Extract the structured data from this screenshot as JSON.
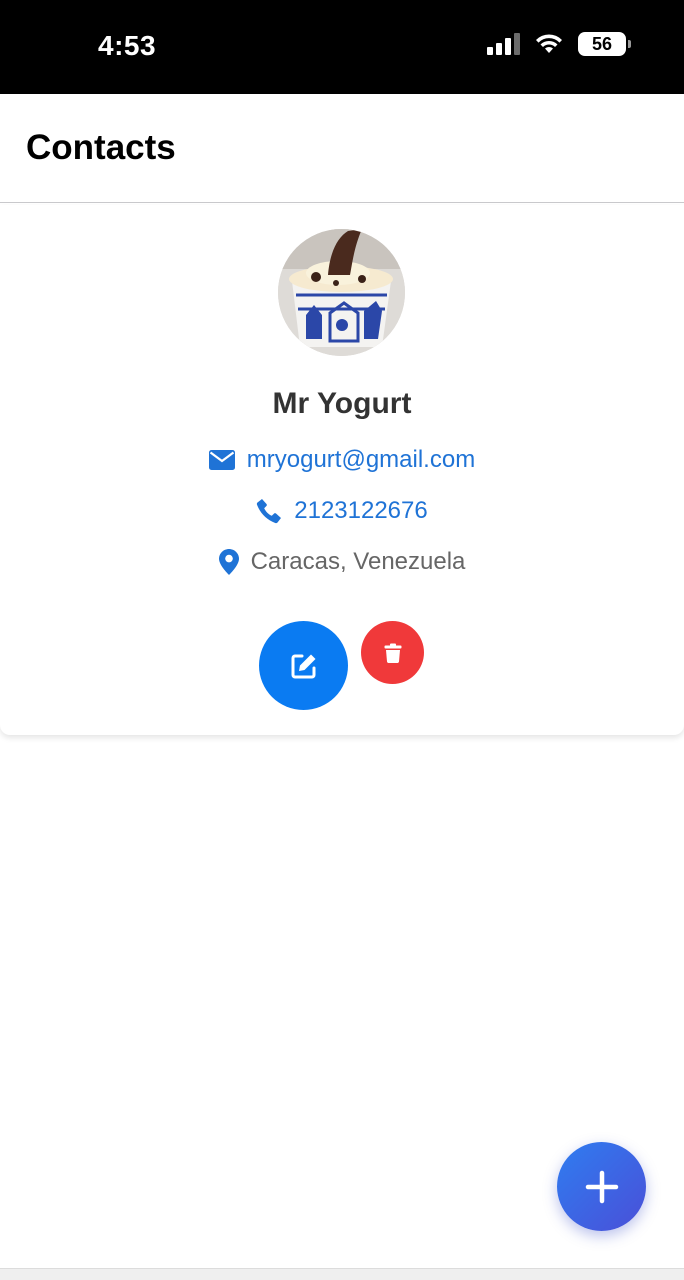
{
  "status_bar": {
    "time": "4:53",
    "battery_level": "56",
    "icons": [
      "cellular-signal-icon",
      "wifi-icon",
      "battery-icon"
    ]
  },
  "header": {
    "title": "Contacts"
  },
  "contact": {
    "name": "Mr Yogurt",
    "email": "mryogurt@gmail.com",
    "phone": "2123122676",
    "location": "Caracas, Venezuela",
    "avatar": "frozen-yogurt-cup-photo"
  },
  "actions": {
    "edit_icon": "pencil-square-icon",
    "delete_icon": "trash-icon",
    "add_icon": "plus-icon"
  },
  "colors": {
    "accent": "#0a7bf2",
    "link": "#1f73d6",
    "danger": "#f0393a",
    "fab_gradient_start": "#2f7df0",
    "fab_gradient_end": "#4a4fd8",
    "name_text": "#333333",
    "secondary_text": "#666666"
  }
}
